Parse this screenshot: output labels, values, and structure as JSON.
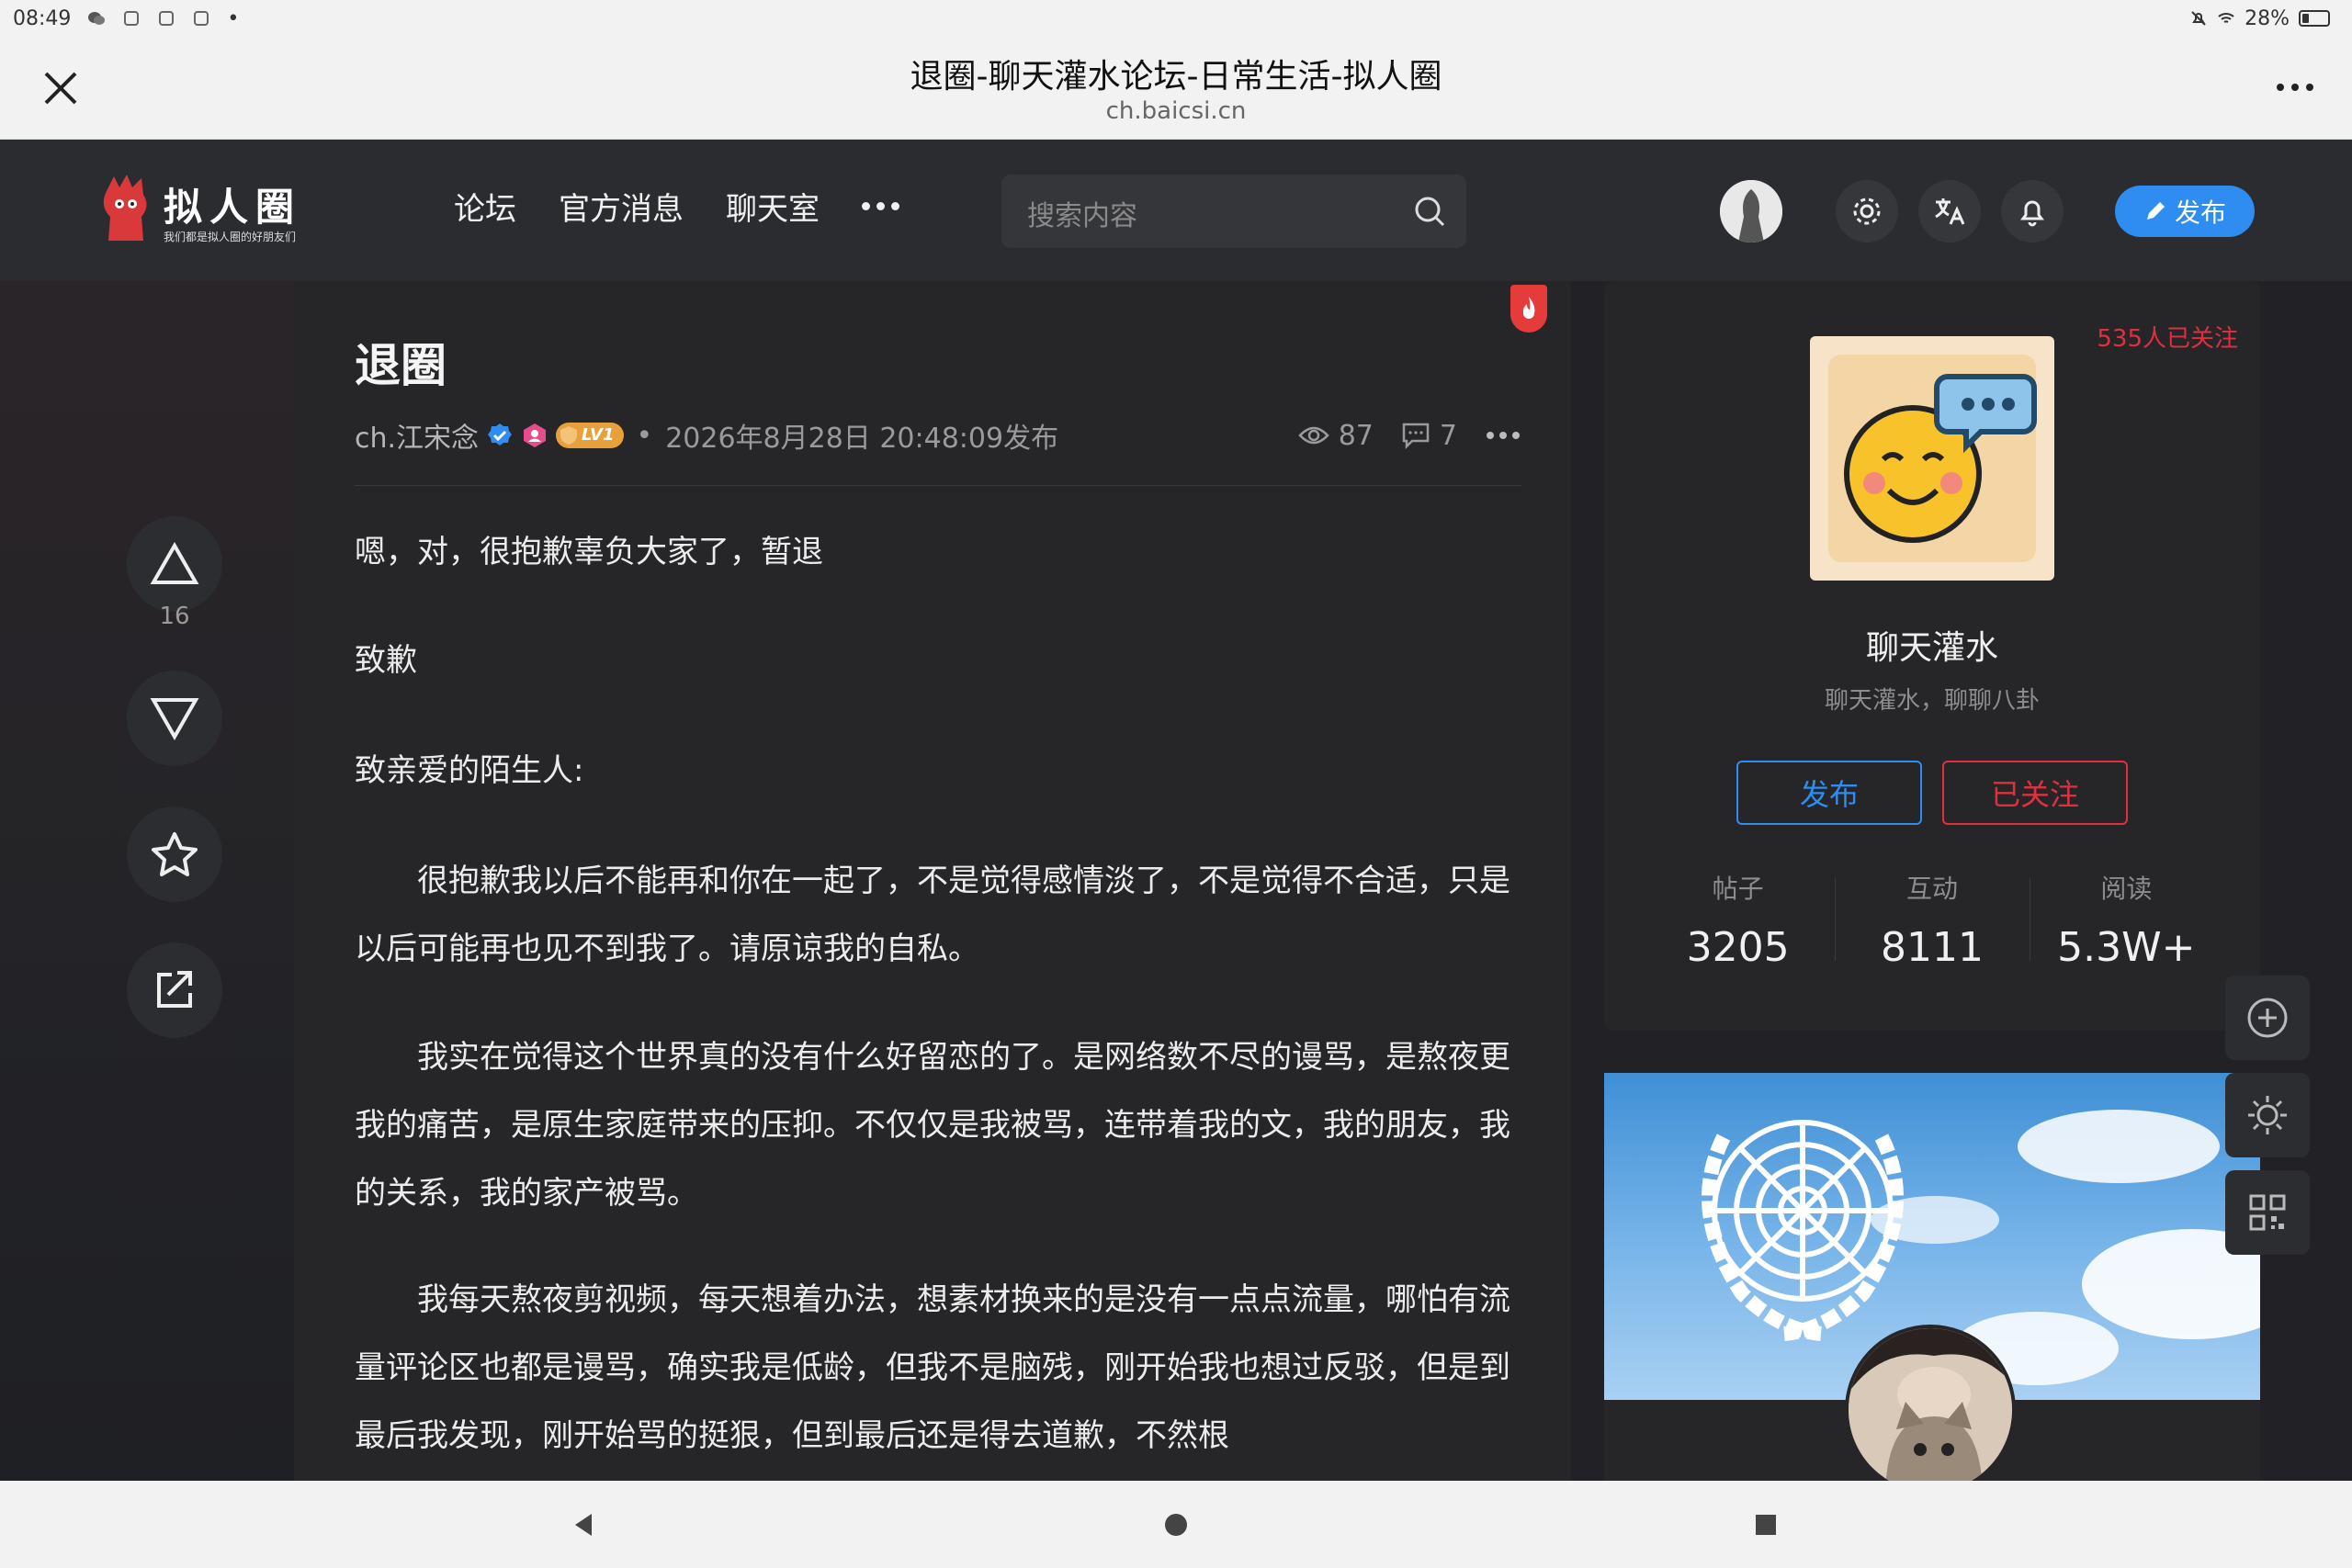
{
  "status_bar": {
    "time": "08:49",
    "battery": "28%",
    "battery_level": 0.28
  },
  "browser": {
    "title": "退圈-聊天灌水论坛-日常生活-拟人圈",
    "url": "ch.baicsi.cn"
  },
  "site": {
    "logo_text": "拟人圈",
    "logo_tagline": "我们都是拟人圈的好朋友们",
    "nav": [
      "论坛",
      "官方消息",
      "聊天室"
    ],
    "search_placeholder": "搜索内容",
    "publish_label": "发布"
  },
  "vote": {
    "count": "16"
  },
  "post": {
    "title": "退圈",
    "author": "ch.江宋念",
    "level": "LV1",
    "published": "2026年8月28日 20:48:09发布",
    "views": "87",
    "comments": "7",
    "paragraphs": [
      "嗯，对，很抱歉辜负大家了，暂退",
      "致歉",
      "致亲爱的陌生人:",
      "很抱歉我以后不能再和你在一起了，不是觉得感情淡了，不是觉得不合适，只是以后可能再也见不到我了。请原谅我的自私。",
      "我实在觉得这个世界真的没有什么好留恋的了。是网络数不尽的谩骂，是熬夜更我的痛苦，是原生家庭带来的压抑。不仅仅是我被骂，连带着我的文，我的朋友，我的关系，我的家产被骂。",
      "我每天熬夜剪视频，每天想着办法，想素材换来的是没有一点点流量，哪怕有流量评论区也都是谩骂，确实我是低龄，但我不是脑残，刚开始我也想过反驳，但是到最后我发现，刚开始骂的挺狠，但到最后还是得去道歉，不然根"
    ]
  },
  "board": {
    "followers": "535人已关注",
    "name": "聊天灌水",
    "description": "聊天灌水，聊聊八卦",
    "publish_label": "发布",
    "follow_label": "已关注",
    "stats": [
      {
        "label": "帖子",
        "value": "3205"
      },
      {
        "label": "互动",
        "value": "8111"
      },
      {
        "label": "阅读",
        "value": "5.3W+"
      }
    ]
  },
  "colors": {
    "accent": "#2f8cf0",
    "danger": "#e03040",
    "level_badge": "#e8a03a"
  }
}
